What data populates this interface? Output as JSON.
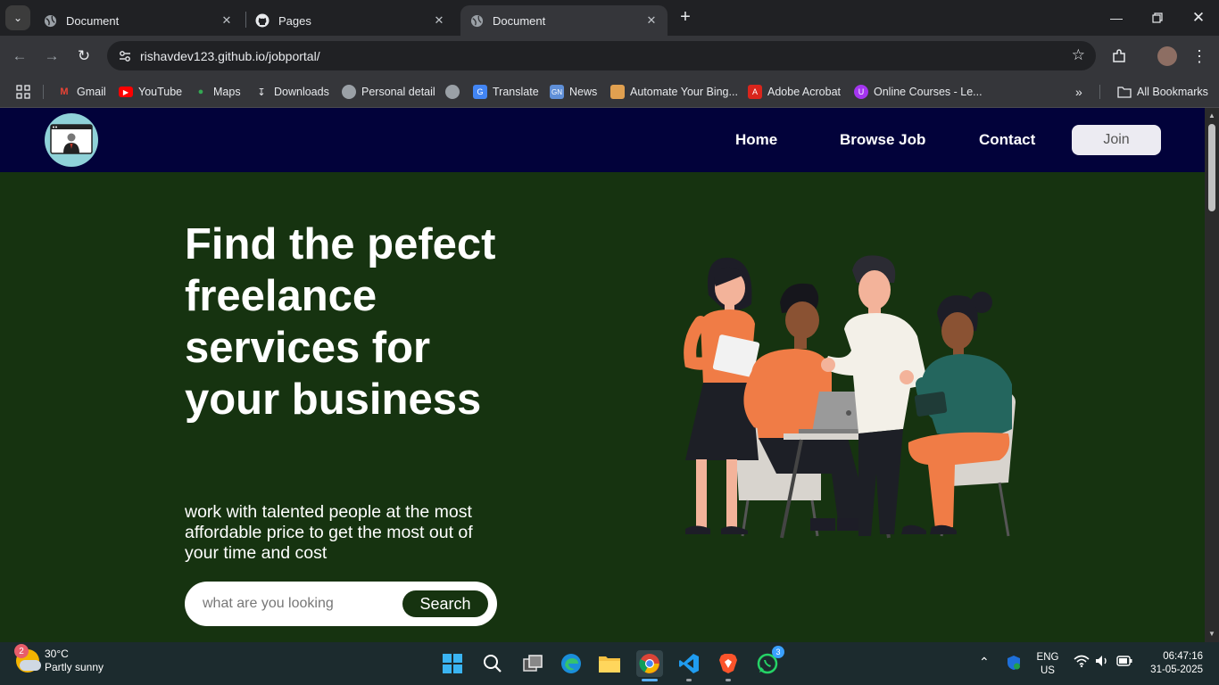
{
  "browser": {
    "tabs": [
      {
        "title": "Document",
        "favicon": "globe-icon",
        "active": false
      },
      {
        "title": "Pages",
        "favicon": "github-icon",
        "active": false
      },
      {
        "title": "Document",
        "favicon": "globe-icon",
        "active": true
      }
    ],
    "url": "rishavdev123.github.io/jobportal/",
    "bookmarks": [
      {
        "label": "Gmail",
        "icon": "gmail-icon"
      },
      {
        "label": "YouTube",
        "icon": "youtube-icon"
      },
      {
        "label": "Maps",
        "icon": "maps-icon"
      },
      {
        "label": "Downloads",
        "icon": "download-icon"
      },
      {
        "label": "Personal detail",
        "icon": "globe-icon"
      },
      {
        "label": "",
        "icon": "globe-icon"
      },
      {
        "label": "Translate",
        "icon": "translate-icon"
      },
      {
        "label": "News",
        "icon": "news-icon"
      },
      {
        "label": "Automate Your Bing...",
        "icon": "automate-icon"
      },
      {
        "label": "Adobe Acrobat",
        "icon": "acrobat-icon"
      },
      {
        "label": "Online Courses - Le...",
        "icon": "udemy-icon"
      }
    ],
    "all_bookmarks": "All Bookmarks"
  },
  "site": {
    "nav": {
      "home": "Home",
      "browse": "Browse Job",
      "contact": "Contact",
      "join": "Join"
    },
    "hero": {
      "title": "Find the pefect freelance services for your business",
      "subtitle": "work with talented people at the most affordable price to get the most out of your time and cost",
      "search_placeholder": "what are you looking",
      "search_button": "Search"
    },
    "colors": {
      "navbar": "#02023a",
      "hero_bg": "#163310",
      "accent_orange": "#f07c46",
      "accent_teal": "#24665e"
    }
  },
  "taskbar": {
    "weather": {
      "temp": "30°C",
      "condition": "Partly sunny",
      "badge": "2"
    },
    "whatsapp_badge": "3",
    "lang": {
      "line1": "ENG",
      "line2": "US"
    },
    "clock": {
      "time": "06:47:16",
      "date": "31-05-2025"
    }
  }
}
